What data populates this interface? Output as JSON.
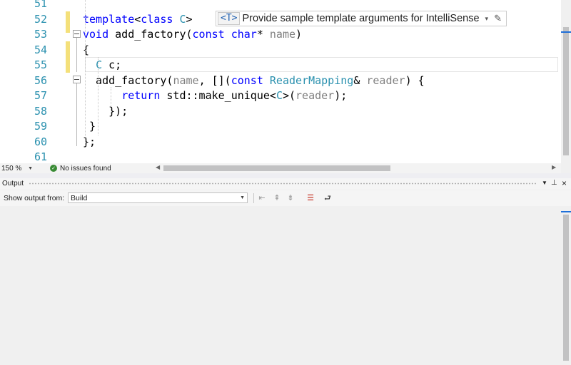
{
  "editor": {
    "lines": [
      {
        "num": "51",
        "tokens": []
      },
      {
        "num": "52",
        "tokens": [
          {
            "t": "template",
            "c": "kw"
          },
          {
            "t": "<",
            "c": ""
          },
          {
            "t": "class",
            "c": "kw"
          },
          {
            "t": " ",
            "c": ""
          },
          {
            "t": "C",
            "c": "ty"
          },
          {
            "t": ">",
            "c": ""
          }
        ]
      },
      {
        "num": "53",
        "tokens": [
          {
            "t": "void",
            "c": "kw"
          },
          {
            "t": " add_factory(",
            "c": ""
          },
          {
            "t": "const",
            "c": "kw"
          },
          {
            "t": " ",
            "c": ""
          },
          {
            "t": "char",
            "c": "kw"
          },
          {
            "t": "* ",
            "c": ""
          },
          {
            "t": "name",
            "c": "param"
          },
          {
            "t": ")",
            "c": ""
          }
        ]
      },
      {
        "num": "54",
        "tokens": [
          {
            "t": "{",
            "c": ""
          }
        ]
      },
      {
        "num": "55",
        "tokens": [
          {
            "t": "  ",
            "c": ""
          },
          {
            "t": "C",
            "c": "ty"
          },
          {
            "t": " c;",
            "c": ""
          }
        ]
      },
      {
        "num": "56",
        "tokens": [
          {
            "t": "  add_factory(",
            "c": ""
          },
          {
            "t": "name",
            "c": "param"
          },
          {
            "t": ", [](",
            "c": ""
          },
          {
            "t": "const",
            "c": "kw"
          },
          {
            "t": " ",
            "c": ""
          },
          {
            "t": "ReaderMapping",
            "c": "ty"
          },
          {
            "t": "& ",
            "c": ""
          },
          {
            "t": "reader",
            "c": "param"
          },
          {
            "t": ") {",
            "c": ""
          }
        ]
      },
      {
        "num": "57",
        "tokens": [
          {
            "t": "      ",
            "c": ""
          },
          {
            "t": "return",
            "c": "kw"
          },
          {
            "t": " std::make_unique<",
            "c": ""
          },
          {
            "t": "C",
            "c": "ty"
          },
          {
            "t": ">(",
            "c": ""
          },
          {
            "t": "reader",
            "c": "param"
          },
          {
            "t": ");",
            "c": ""
          }
        ]
      },
      {
        "num": "58",
        "tokens": [
          {
            "t": "    });",
            "c": ""
          }
        ]
      },
      {
        "num": "59",
        "tokens": [
          {
            "t": " }",
            "c": ""
          }
        ]
      },
      {
        "num": "60",
        "tokens": [
          {
            "t": "};",
            "c": ""
          }
        ]
      },
      {
        "num": "61",
        "tokens": []
      }
    ],
    "template_hint": {
      "badge": "<T>",
      "text": "Provide sample template arguments for IntelliSense",
      "caret": "▾",
      "wrench": "✎"
    }
  },
  "status": {
    "zoom": "150 %",
    "issues_text": "No issues found",
    "issues_icon": "check-circle-icon"
  },
  "output": {
    "title": "Output",
    "show_label": "Show output from:",
    "source": "Build",
    "buttons": [
      "go-to-previous-message-icon",
      "go-to-next-message-icon",
      "clear-all-icon",
      "toggle-word-wrap-icon"
    ]
  },
  "colors": {
    "keyword": "#0000ff",
    "type": "#2b91af",
    "parameter": "#808080",
    "change_marker": "#f4e07a",
    "accent": "#1e6fd9"
  }
}
